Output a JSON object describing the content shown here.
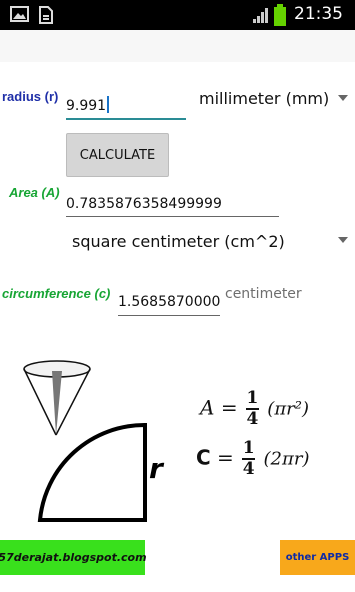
{
  "status_bar": {
    "time": "21:35"
  },
  "radius": {
    "label": "radius (r)",
    "value": "9.991",
    "unit": "millimeter (mm)"
  },
  "calculate_button": {
    "label": "CALCULATE"
  },
  "area": {
    "label": "Area (A)",
    "value": "0.7835876358499999",
    "unit": "square centimeter (cm^2)"
  },
  "circumference": {
    "label": "circumference (c)",
    "value": "1.5685870000",
    "unit": "centimeter"
  },
  "formulas": {
    "area": {
      "lhs": "A",
      "eq": "=",
      "num": "1",
      "den": "4",
      "rhs": "(πr²)"
    },
    "circ": {
      "lhs": "C",
      "eq": "=",
      "num": "1",
      "den": "4",
      "rhs": "(2πr)"
    },
    "r_label": "r"
  },
  "footer": {
    "website": "57derajat.blogspot.com",
    "other_apps": "other APPS"
  },
  "colors": {
    "blue_label": "#1f2fa8",
    "green_label": "#17a534",
    "banner": "#39e01c",
    "other_apps": "#f8a81b"
  }
}
